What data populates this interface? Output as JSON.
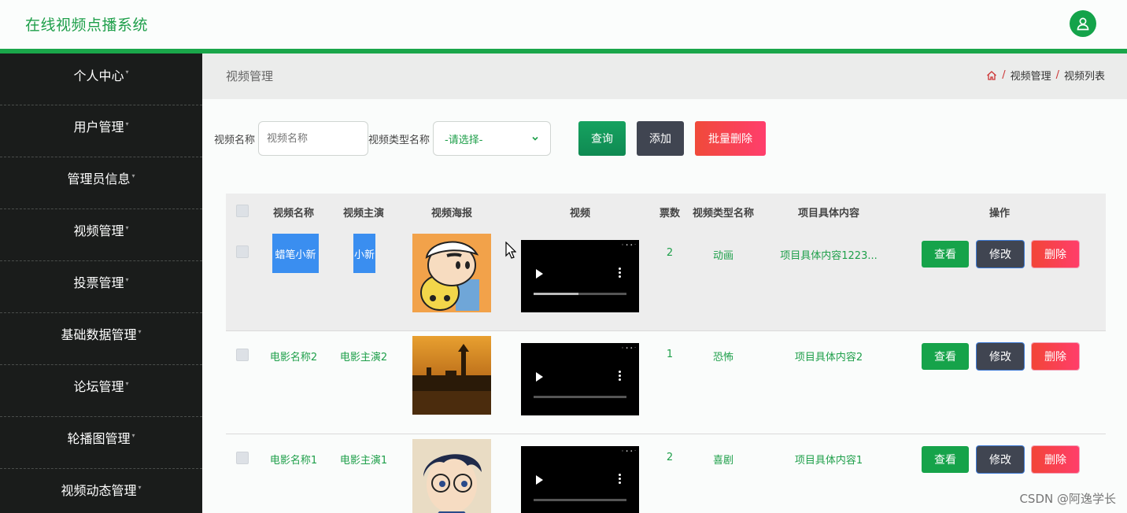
{
  "header": {
    "title": "在线视频点播系统",
    "avatar_icon": "user-icon"
  },
  "sidebar": {
    "items": [
      {
        "label": "个人中心"
      },
      {
        "label": "用户管理"
      },
      {
        "label": "管理员信息"
      },
      {
        "label": "视频管理"
      },
      {
        "label": "投票管理"
      },
      {
        "label": "基础数据管理"
      },
      {
        "label": "论坛管理"
      },
      {
        "label": "轮播图管理"
      },
      {
        "label": "视频动态管理"
      }
    ]
  },
  "page": {
    "title": "视频管理",
    "breadcrumb": [
      "视频管理",
      "视频列表"
    ],
    "breadcrumb_sep": "/"
  },
  "search": {
    "name_label": "视频名称",
    "name_placeholder": "视频名称",
    "type_label": "视频类型名称",
    "type_selected": "-请选择-",
    "query_label": "查询",
    "add_label": "添加",
    "bulk_delete_label": "批量删除"
  },
  "table": {
    "headers": [
      "视频名称",
      "视频主演",
      "视频海报",
      "视频",
      "票数",
      "视频类型名称",
      "项目具体内容",
      "操作"
    ],
    "rows": [
      {
        "name": "蜡笔小新",
        "actor": "小新",
        "votes": "2",
        "type": "动画",
        "content": "项目具体内容1223...",
        "progress": 0.48
      },
      {
        "name": "电影名称2",
        "actor": "电影主演2",
        "votes": "1",
        "type": "恐怖",
        "content": "项目具体内容2",
        "progress": 0.0
      },
      {
        "name": "电影名称1",
        "actor": "电影主演1",
        "votes": "2",
        "type": "喜剧",
        "content": "项目具体内容1",
        "progress": 0.0
      }
    ],
    "actions": {
      "view": "查看",
      "edit": "修改",
      "delete": "删除"
    }
  },
  "watermark": "CSDN @阿逸学长",
  "colors": {
    "brand": "#1aa64a",
    "danger": "#ff3e6a",
    "dark": "#404551",
    "highlight": "#3a8ef0"
  }
}
